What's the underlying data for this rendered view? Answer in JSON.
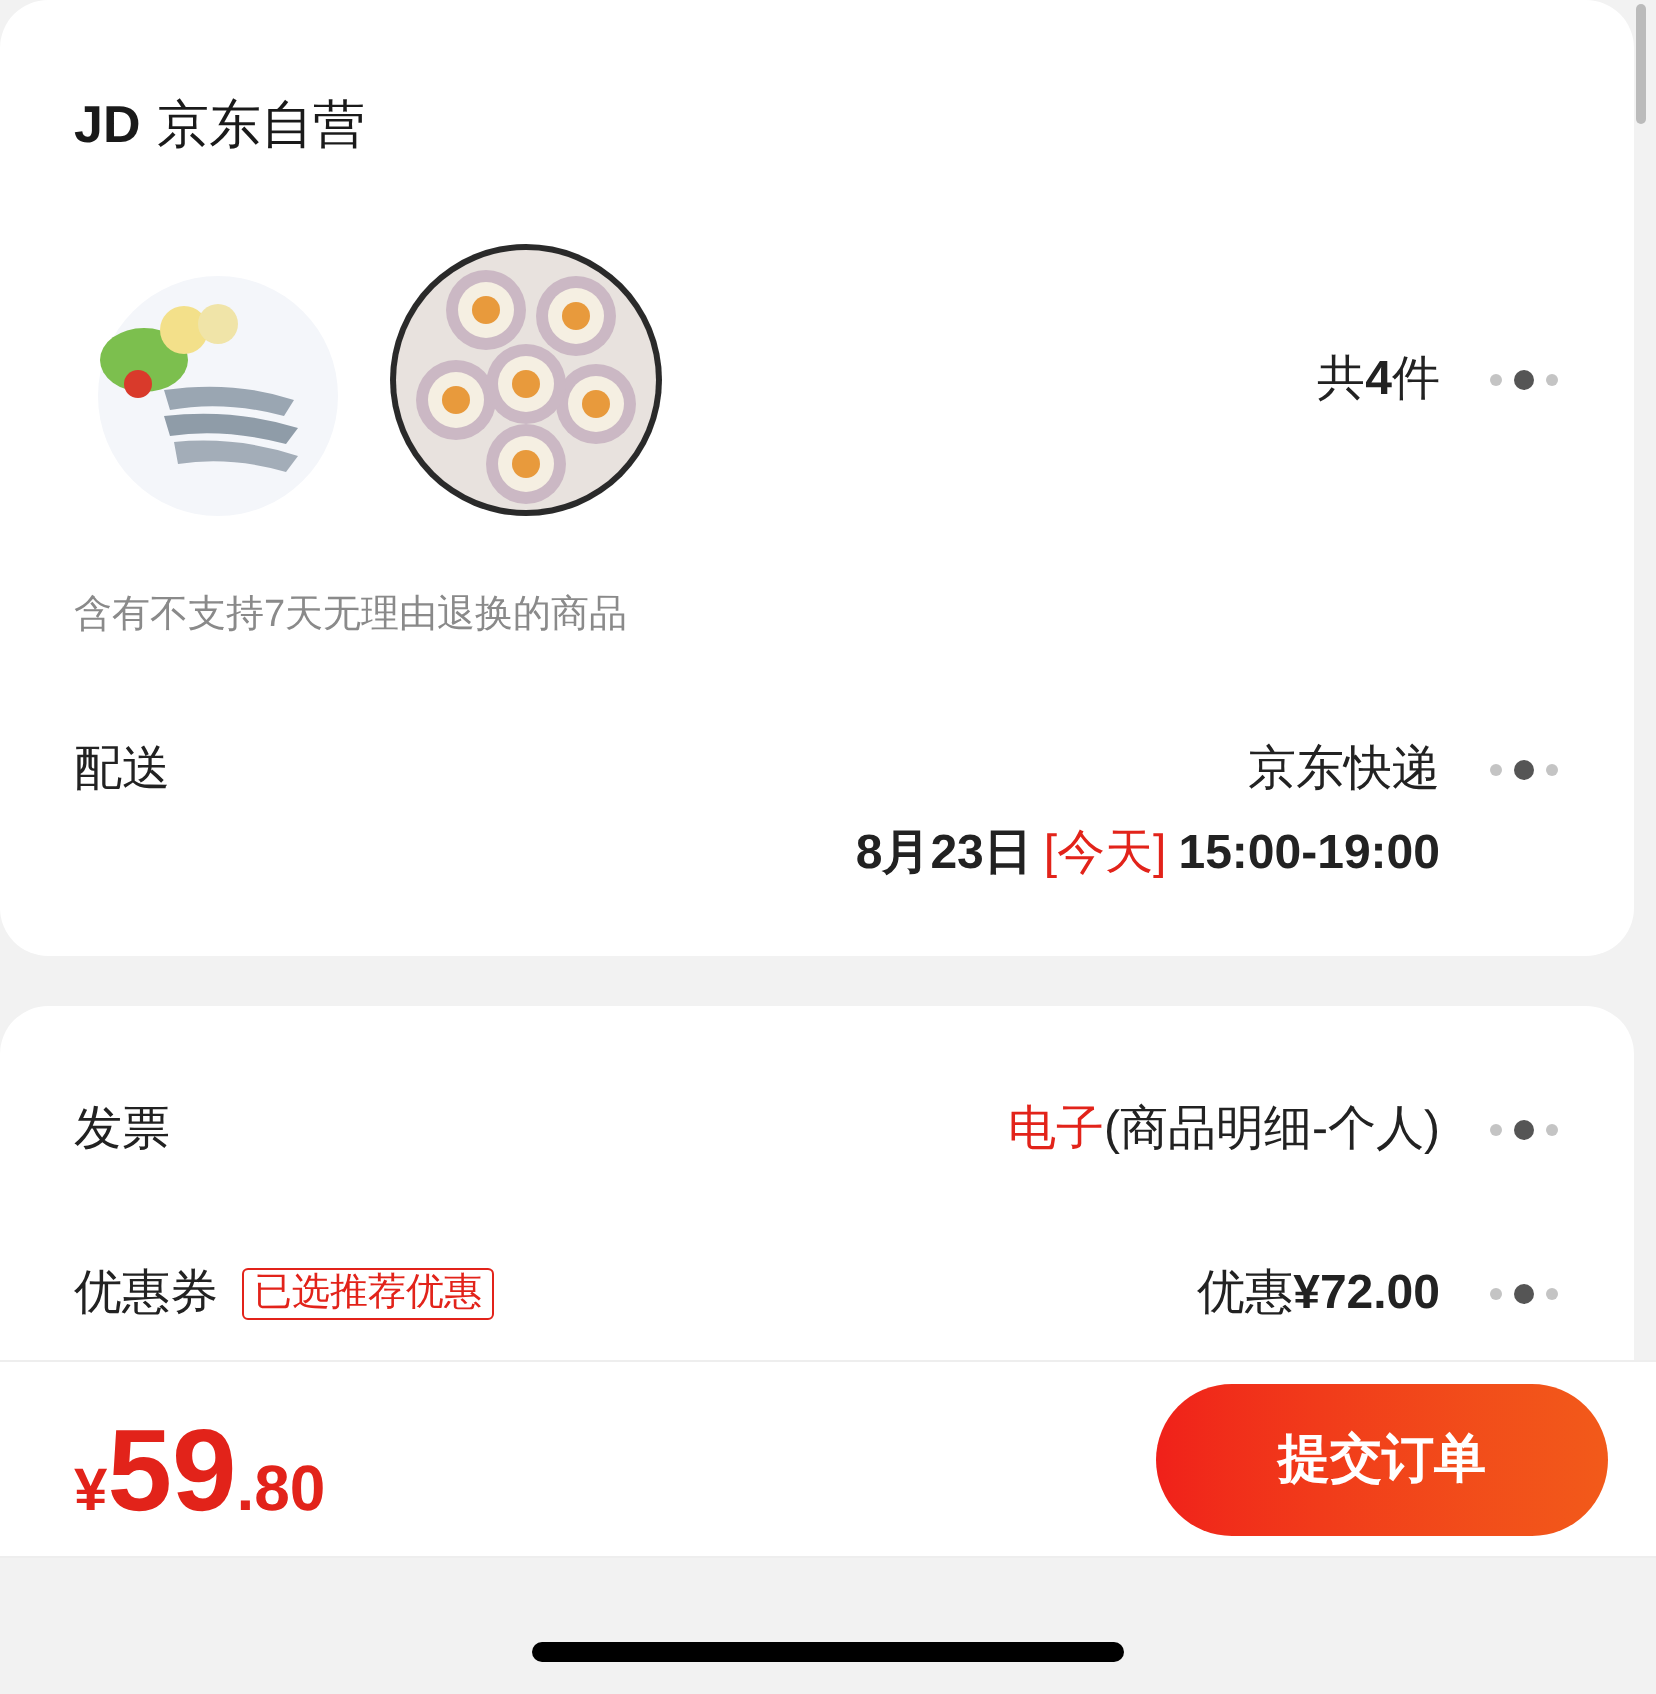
{
  "store": {
    "logo": "JD",
    "name": "京东自营"
  },
  "products": {
    "count": "共**4**件",
    "note": "含有不支持7天无理由退换的商品"
  },
  "delivery": {
    "label": "配送",
    "carrier": "京东快递",
    "date": "8月23日",
    "day_tag": "[今天]",
    "time": "15:00-19:00"
  },
  "invoice": {
    "label": "发票",
    "type": "电子",
    "detail": "(商品明细-个人)"
  },
  "coupon": {
    "label": "优惠券",
    "tag": "已选推荐优惠",
    "value": "优惠**¥72.00**"
  },
  "footer": {
    "currency": "¥",
    "price_integer": "59",
    "price_decimal": ".80",
    "submit": "提交订单"
  }
}
